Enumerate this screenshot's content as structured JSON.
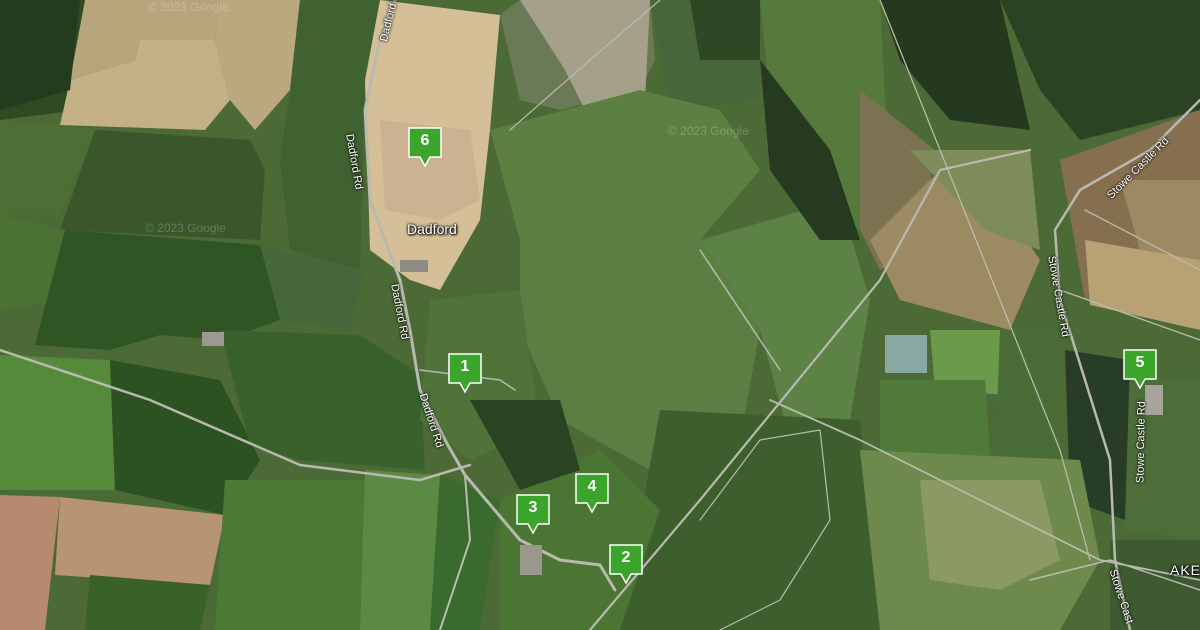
{
  "map": {
    "type": "satellite",
    "place_labels": [
      {
        "id": "dadford",
        "text": "Dadford"
      },
      {
        "id": "ake",
        "text": "AKE"
      }
    ],
    "road_labels": [
      {
        "id": "dadford-rd-1",
        "text": "Dadford Rd"
      },
      {
        "id": "dadford-rd-2",
        "text": "Dadford Rd"
      },
      {
        "id": "dadford-rd-3",
        "text": "Dadford Rd"
      },
      {
        "id": "dadford-rd-4",
        "text": "Dadford Rd"
      },
      {
        "id": "stowe-castle-rd-1",
        "text": "Stowe Castle Rd"
      },
      {
        "id": "stowe-castle-rd-2",
        "text": "Stowe Castle Rd"
      },
      {
        "id": "stowe-castle-rd-3",
        "text": "Stowe Castle Rd"
      },
      {
        "id": "stowe-castle-rd-4",
        "text": "Stowe Cast"
      }
    ],
    "watermarks": [
      "© 2023 Google",
      "© 2023 Google",
      "© 2023 Google"
    ],
    "markers": [
      {
        "id": "1",
        "label": "1"
      },
      {
        "id": "2",
        "label": "2"
      },
      {
        "id": "3",
        "label": "3"
      },
      {
        "id": "4",
        "label": "4"
      },
      {
        "id": "5",
        "label": "5"
      },
      {
        "id": "6",
        "label": "6"
      }
    ],
    "colors": {
      "marker_fill": "#3aa52a",
      "marker_border": "#ffffff",
      "road": "#b9b9b0",
      "field_dark": "#3b5a28",
      "field_light": "#5e8040"
    }
  }
}
